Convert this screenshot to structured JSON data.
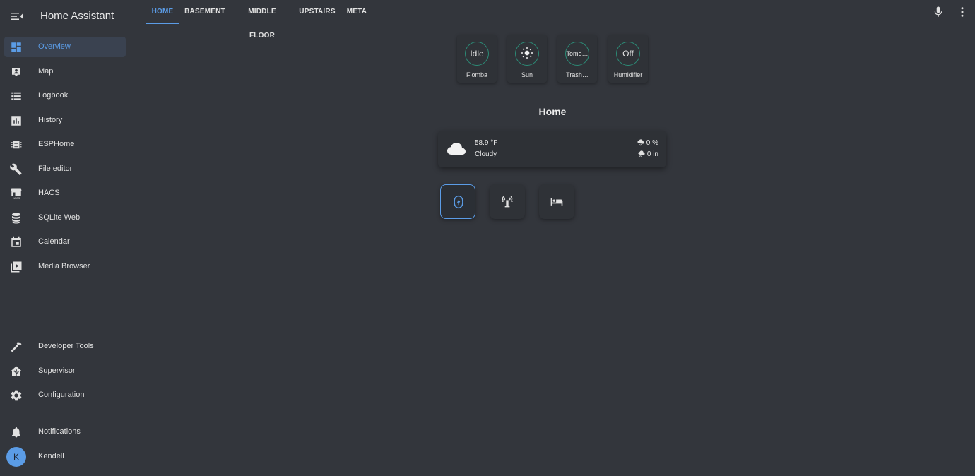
{
  "app": {
    "title": "Home Assistant"
  },
  "colors": {
    "background": "#33363c",
    "accent": "#5b9ce6",
    "badge_ring": "#2c8c77"
  },
  "sidebar": {
    "items": [
      {
        "label": "Overview",
        "icon": "dashboard-icon",
        "active": true
      },
      {
        "label": "Map",
        "icon": "map-icon"
      },
      {
        "label": "Logbook",
        "icon": "list-icon"
      },
      {
        "label": "History",
        "icon": "chart-box-icon"
      },
      {
        "label": "ESPHome",
        "icon": "chip-icon"
      },
      {
        "label": "File editor",
        "icon": "wrench-icon"
      },
      {
        "label": "HACS",
        "icon": "hacs-icon"
      },
      {
        "label": "SQLite Web",
        "icon": "database-icon"
      },
      {
        "label": "Calendar",
        "icon": "calendar-icon"
      },
      {
        "label": "Media Browser",
        "icon": "play-box-icon"
      }
    ],
    "bottom_items": [
      {
        "label": "Developer Tools",
        "icon": "hammer-icon"
      },
      {
        "label": "Supervisor",
        "icon": "home-assistant-icon"
      },
      {
        "label": "Configuration",
        "icon": "gear-icon"
      },
      {
        "label": "Notifications",
        "icon": "bell-icon"
      }
    ],
    "user": {
      "initial": "K",
      "name": "Kendell"
    }
  },
  "tabs": [
    "HOME",
    "BASEMENT",
    "MIDDLE FLOOR",
    "UPSTAIRS",
    "META"
  ],
  "active_tab": "HOME",
  "badges": [
    {
      "state": "Idle",
      "label": "Fiomba"
    },
    {
      "state": "",
      "icon": "sun-icon",
      "label": "Sun"
    },
    {
      "state": "Tomo…",
      "label": "Trash…"
    },
    {
      "state": "Off",
      "label": "Humidifier"
    }
  ],
  "section": {
    "title": "Home"
  },
  "weather": {
    "temperature": "58.9 °F",
    "condition": "Cloudy",
    "precip_probability": "0 %",
    "precipitation": "0 in",
    "icon": "cloud-icon"
  },
  "buttons": [
    {
      "icon": "shield-lightning-icon",
      "active": true
    },
    {
      "icon": "sprinkler-icon"
    },
    {
      "icon": "bed-icon"
    }
  ]
}
